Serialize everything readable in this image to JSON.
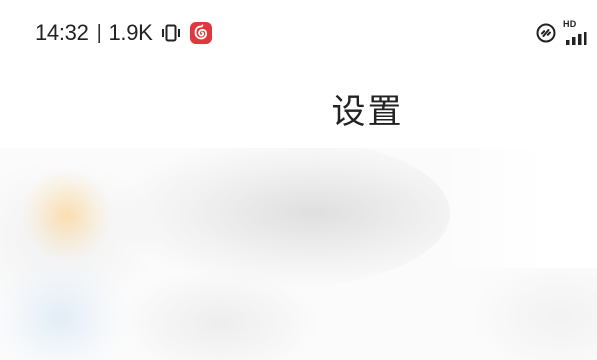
{
  "status_bar": {
    "time": "14:32",
    "separator": "|",
    "network_speed": "1.9K",
    "network_type_label": "HD",
    "icons": [
      "vibrate-icon",
      "app-notification-icon",
      "link-icon",
      "signal-icon"
    ],
    "app_badge_color": "#e0373c"
  },
  "header": {
    "title": "设置"
  }
}
